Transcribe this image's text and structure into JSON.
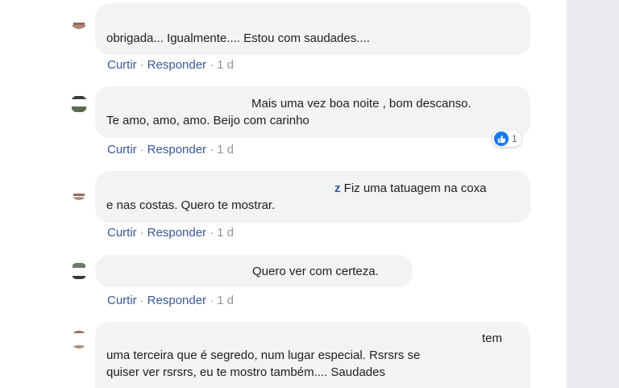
{
  "comments": [
    {
      "name_fragment": "",
      "text_line1": "obrigada... Igualmente.... Estou com saudades....",
      "text_line2": "",
      "action_like": "Curtir",
      "action_reply": "Responder",
      "time": "1 d",
      "reaction_count": ""
    },
    {
      "name_fragment": "",
      "text_line1": "Mais uma vez boa noite , bom descanso.",
      "text_line2": "Te amo, amo, amo. Beijo com carinho",
      "action_like": "Curtir",
      "action_reply": "Responder",
      "time": "1 d",
      "reaction_count": "1"
    },
    {
      "name_fragment": "z",
      "text_line1": "Fiz uma tatuagem na coxa",
      "text_line2": "e nas costas. Quero te mostrar.",
      "action_like": "Curtir",
      "action_reply": "Responder",
      "time": "1 d",
      "reaction_count": ""
    },
    {
      "name_fragment": "",
      "text_line1": "Quero ver com certeza.",
      "text_line2": "",
      "action_like": "Curtir",
      "action_reply": "Responder",
      "time": "1 d",
      "reaction_count": ""
    },
    {
      "name_fragment": "",
      "text_line1": "tem",
      "text_line2": "uma terceira que é segredo, num lugar especial. Rsrsrs se",
      "text_line3": "quiser ver rsrsrs, eu te mostro também.... Saudades"
    }
  ],
  "colors": {
    "link": "#385898",
    "bubble": "#f2f3f5",
    "meta": "#90949c",
    "like": "#1877f2"
  },
  "icons": {
    "reaction": "like-thumb-icon"
  }
}
